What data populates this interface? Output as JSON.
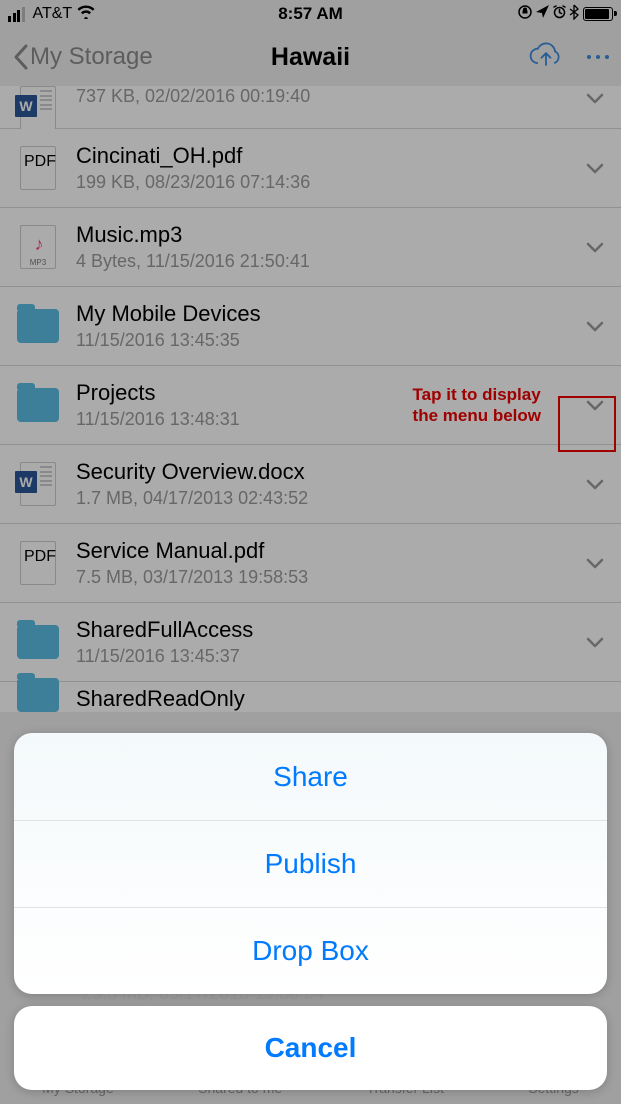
{
  "statusbar": {
    "carrier": "AT&T",
    "time": "8:57 AM"
  },
  "nav": {
    "back_label": "My Storage",
    "title": "Hawaii"
  },
  "files": [
    {
      "name": "",
      "meta": "737 KB, 02/02/2016 00:19:40",
      "kind": "word",
      "partial_top": true
    },
    {
      "name": "Cincinati_OH.pdf",
      "meta": "199 KB, 08/23/2016 07:14:36",
      "kind": "pdf"
    },
    {
      "name": "Music.mp3",
      "meta": "4 Bytes, 11/15/2016 21:50:41",
      "kind": "mp3"
    },
    {
      "name": "My Mobile Devices",
      "meta": "11/15/2016 13:45:35",
      "kind": "folder"
    },
    {
      "name": "Projects",
      "meta": "11/15/2016 13:48:31",
      "kind": "folder",
      "highlighted": true
    },
    {
      "name": "Security Overview.docx",
      "meta": "1.7 MB, 04/17/2013 02:43:52",
      "kind": "word"
    },
    {
      "name": "Service Manual.pdf",
      "meta": "7.5 MB, 03/17/2013 19:58:53",
      "kind": "pdf"
    },
    {
      "name": "SharedFullAccess",
      "meta": "11/15/2016 13:45:37",
      "kind": "folder"
    },
    {
      "name": "SharedReadOnly",
      "meta": "",
      "kind": "folder",
      "partial_bottom": true
    }
  ],
  "under_meta": "25.3 MB, 03/17/2013 19:58:34",
  "annotation": {
    "line1": "Tap it to display",
    "line2": "the menu below"
  },
  "sheet": {
    "items": [
      "Share",
      "Publish",
      "Drop Box"
    ],
    "cancel": "Cancel"
  },
  "tabs": [
    "My Storage",
    "Shared to me",
    "Transfer List",
    "Settings"
  ]
}
